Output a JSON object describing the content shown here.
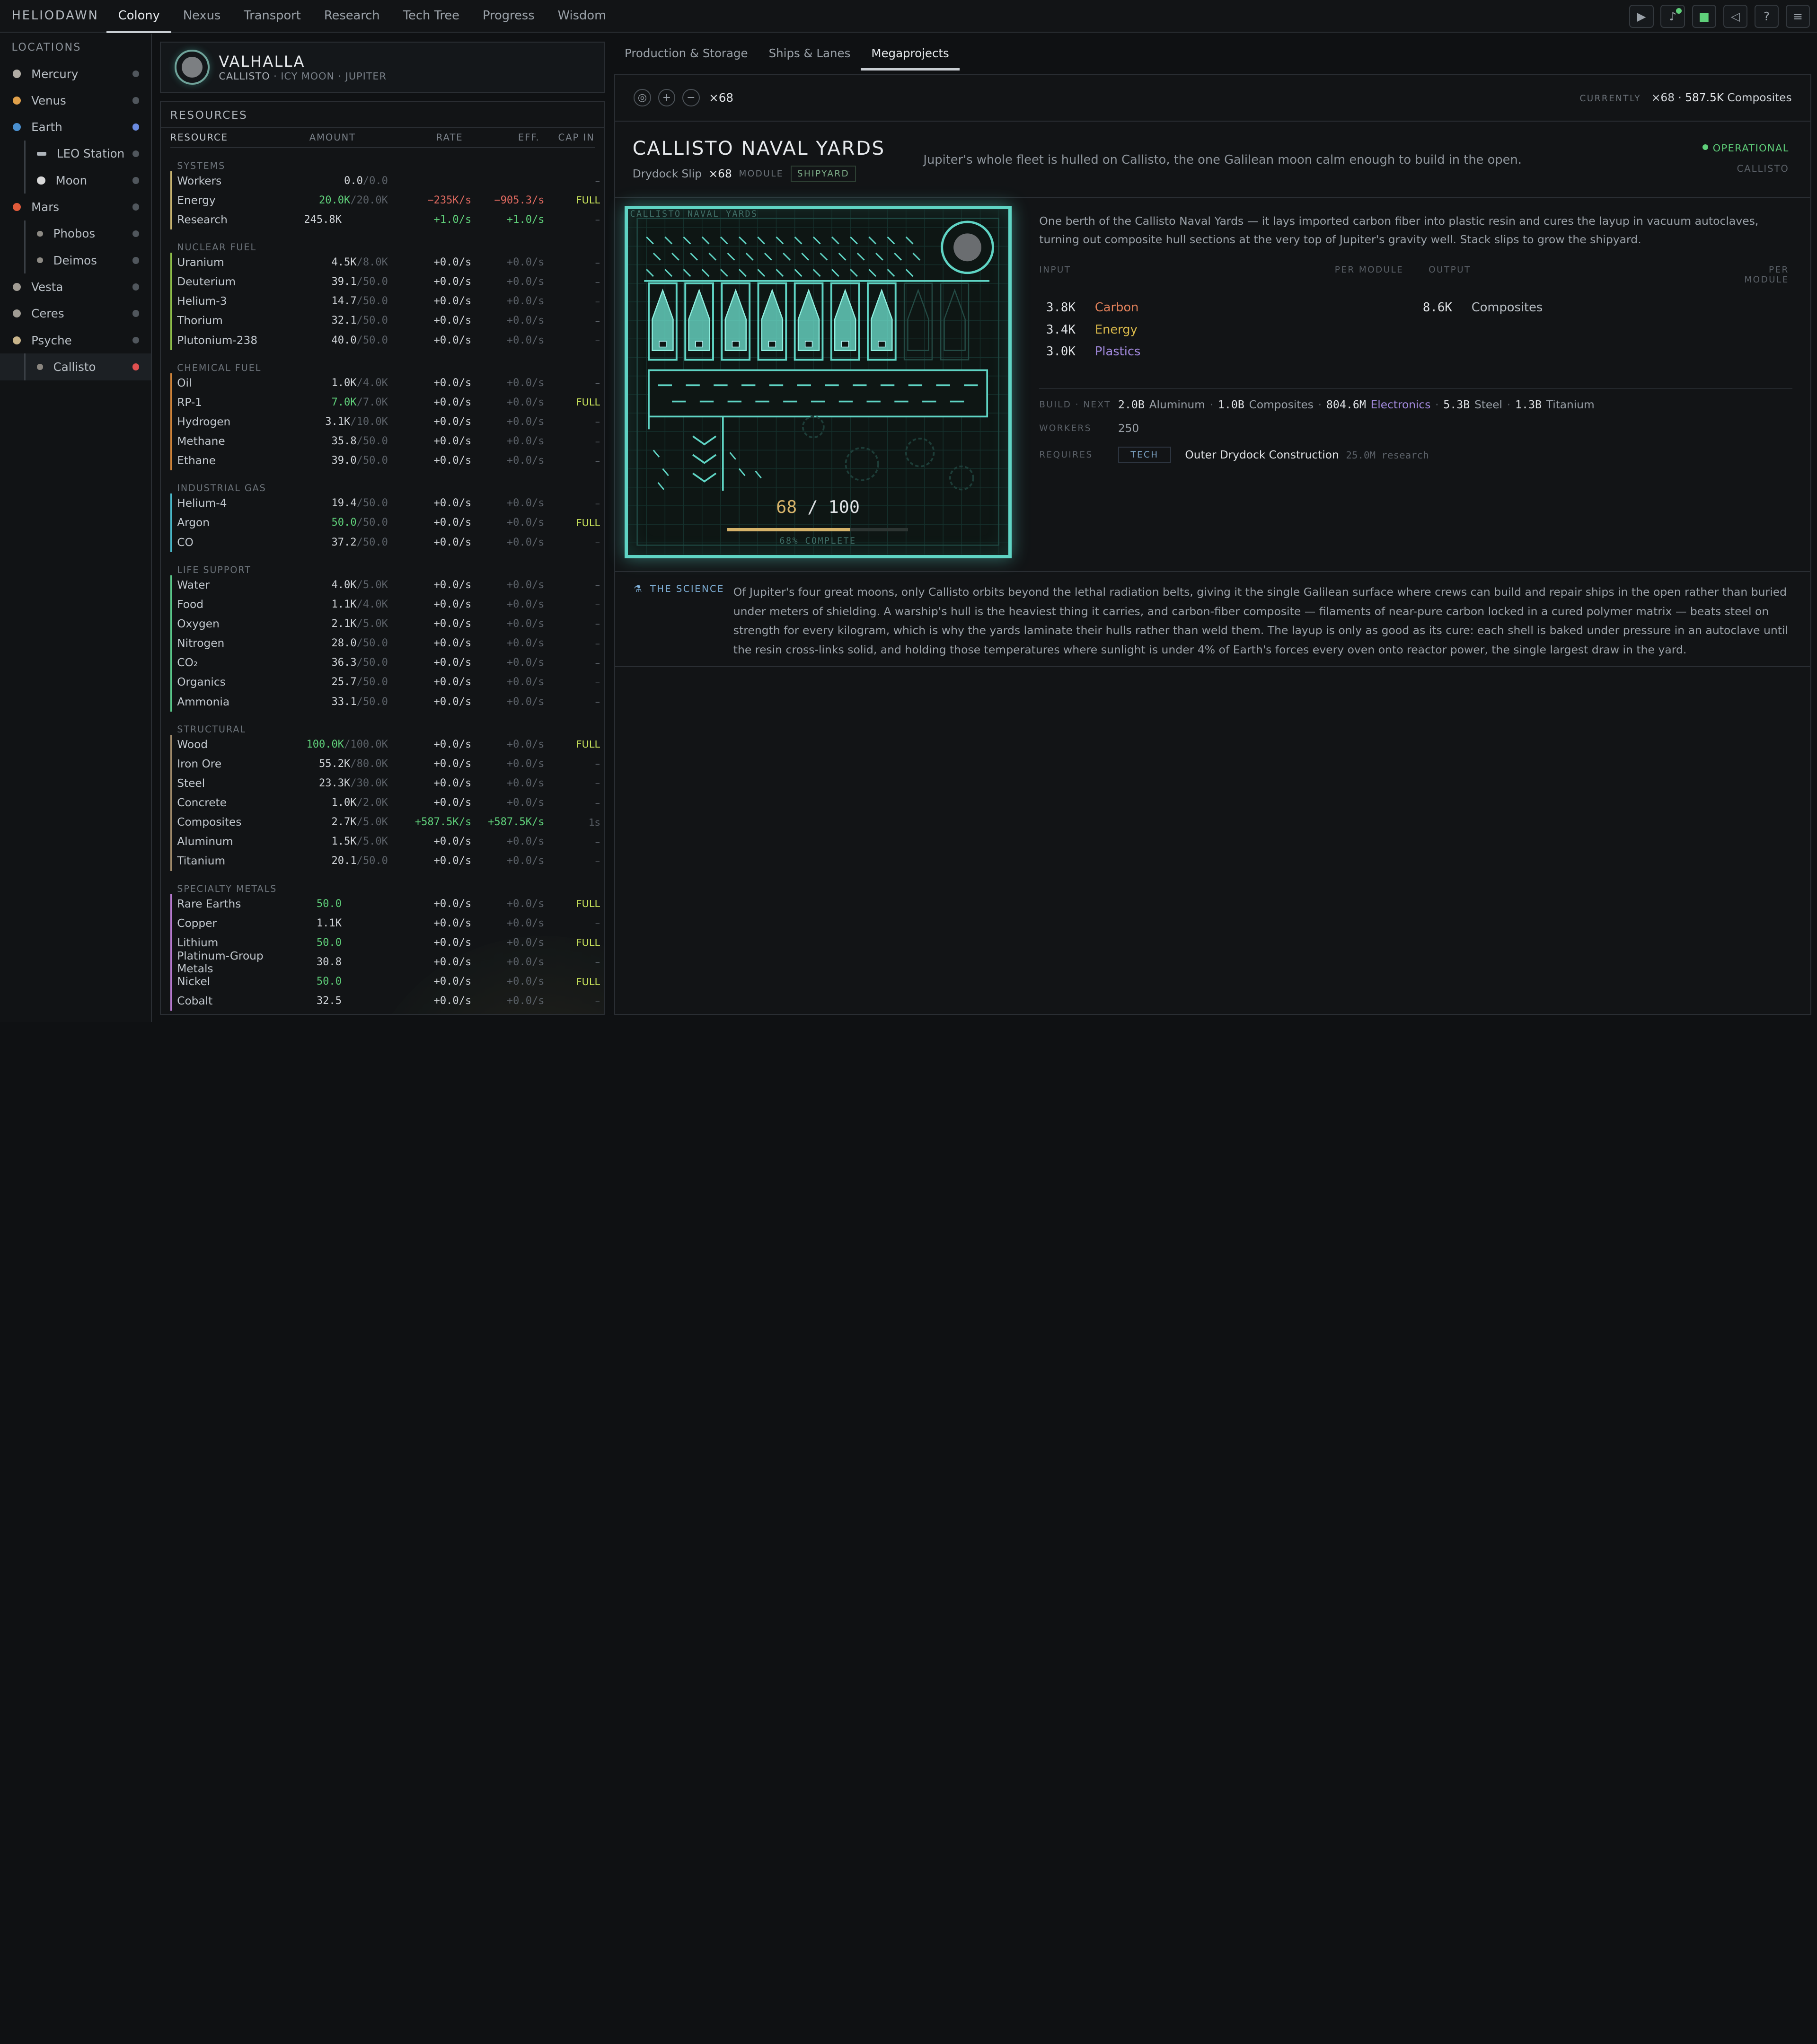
{
  "brand": "HELIODAWN",
  "nav": {
    "tabs": [
      {
        "label": "Colony",
        "active": true
      },
      {
        "label": "Nexus",
        "active": false
      },
      {
        "label": "Transport",
        "active": false
      },
      {
        "label": "Research",
        "active": false
      },
      {
        "label": "Tech Tree",
        "active": false
      },
      {
        "label": "Progress",
        "active": false
      },
      {
        "label": "Wisdom",
        "active": false
      }
    ]
  },
  "topicons": [
    "play-icon",
    "bell-icon",
    "save-icon",
    "mute-icon",
    "help-icon",
    "menu-icon"
  ],
  "sidebar": {
    "title": "LOCATIONS",
    "items": [
      {
        "label": "Mercury",
        "color": "#b0aca4",
        "child": false,
        "status": "#50565c"
      },
      {
        "label": "Venus",
        "color": "#e0a04a",
        "child": false,
        "status": "#50565c"
      },
      {
        "label": "Earth",
        "color": "#4a90d0",
        "child": false,
        "status": "#6b8be0"
      },
      {
        "label": "LEO Station",
        "color": "#aeb4ba",
        "child": true,
        "status": "#50565c"
      },
      {
        "label": "Moon",
        "color": "#d8d8d8",
        "child": true,
        "status": "#50565c"
      },
      {
        "label": "Mars",
        "color": "#e05a3a",
        "child": false,
        "status": "#50565c"
      },
      {
        "label": "Phobos",
        "color": "#8d8a84",
        "child": true,
        "status": "#50565c"
      },
      {
        "label": "Deimos",
        "color": "#8d8a84",
        "child": true,
        "status": "#50565c"
      },
      {
        "label": "Vesta",
        "color": "#a09c94",
        "child": false,
        "status": "#50565c"
      },
      {
        "label": "Ceres",
        "color": "#a09c94",
        "child": false,
        "status": "#50565c"
      },
      {
        "label": "Psyche",
        "color": "#c8b48a",
        "child": false,
        "status": "#50565c"
      },
      {
        "label": "Callisto",
        "color": "#8a8680",
        "child": true,
        "status": "#e05050",
        "selected": true
      }
    ]
  },
  "location": {
    "name": "VALHALLA",
    "body": "CALLISTO",
    "sub": "· ICY MOON · JUPITER"
  },
  "resources": {
    "title": "RESOURCES",
    "headers": [
      "RESOURCE",
      "AMOUNT",
      "RATE",
      "EFF.",
      "CAP IN"
    ],
    "categories": [
      {
        "name": "SYSTEMS",
        "color": "#c8b470",
        "rows": [
          {
            "name": "Workers",
            "amt": "0.0",
            "cap": "/0.0",
            "rate": "",
            "eff": "",
            "capin": "–"
          },
          {
            "name": "Energy",
            "amt": "20.0K",
            "cap": "/20.0K",
            "rate": "−235K/s",
            "eff": "−905.3/s",
            "capin": "FULL",
            "amtc": "pos",
            "ratec": "neg",
            "effc": "neg"
          },
          {
            "name": "Research",
            "amt": "245.8K",
            "cap": "",
            "rate": "+1.0/s",
            "eff": "+1.0/s",
            "capin": "–",
            "ratec": "pos",
            "effc": "pos"
          }
        ]
      },
      {
        "name": "NUCLEAR FUEL",
        "color": "#8fbf4a",
        "rows": [
          {
            "name": "Uranium",
            "amt": "4.5K",
            "cap": "/8.0K",
            "rate": "+0.0/s",
            "eff": "+0.0/s",
            "capin": "–"
          },
          {
            "name": "Deuterium",
            "amt": "39.1",
            "cap": "/50.0",
            "rate": "+0.0/s",
            "eff": "+0.0/s",
            "capin": "–"
          },
          {
            "name": "Helium-3",
            "amt": "14.7",
            "cap": "/50.0",
            "rate": "+0.0/s",
            "eff": "+0.0/s",
            "capin": "–"
          },
          {
            "name": "Thorium",
            "amt": "32.1",
            "cap": "/50.0",
            "rate": "+0.0/s",
            "eff": "+0.0/s",
            "capin": "–"
          },
          {
            "name": "Plutonium-238",
            "amt": "40.0",
            "cap": "/50.0",
            "rate": "+0.0/s",
            "eff": "+0.0/s",
            "capin": "–"
          }
        ]
      },
      {
        "name": "CHEMICAL FUEL",
        "color": "#d0843a",
        "rows": [
          {
            "name": "Oil",
            "amt": "1.0K",
            "cap": "/4.0K",
            "rate": "+0.0/s",
            "eff": "+0.0/s",
            "capin": "–"
          },
          {
            "name": "RP-1",
            "amt": "7.0K",
            "cap": "/7.0K",
            "rate": "+0.0/s",
            "eff": "+0.0/s",
            "capin": "FULL",
            "amtc": "pos"
          },
          {
            "name": "Hydrogen",
            "amt": "3.1K",
            "cap": "/10.0K",
            "rate": "+0.0/s",
            "eff": "+0.0/s",
            "capin": "–"
          },
          {
            "name": "Methane",
            "amt": "35.8",
            "cap": "/50.0",
            "rate": "+0.0/s",
            "eff": "+0.0/s",
            "capin": "–"
          },
          {
            "name": "Ethane",
            "amt": "39.0",
            "cap": "/50.0",
            "rate": "+0.0/s",
            "eff": "+0.0/s",
            "capin": "–"
          }
        ]
      },
      {
        "name": "INDUSTRIAL GAS",
        "color": "#4ab8c8",
        "rows": [
          {
            "name": "Helium-4",
            "amt": "19.4",
            "cap": "/50.0",
            "rate": "+0.0/s",
            "eff": "+0.0/s",
            "capin": "–"
          },
          {
            "name": "Argon",
            "amt": "50.0",
            "cap": "/50.0",
            "rate": "+0.0/s",
            "eff": "+0.0/s",
            "capin": "FULL",
            "amtc": "pos"
          },
          {
            "name": "CO",
            "amt": "37.2",
            "cap": "/50.0",
            "rate": "+0.0/s",
            "eff": "+0.0/s",
            "capin": "–"
          }
        ]
      },
      {
        "name": "LIFE SUPPORT",
        "color": "#5ac88a",
        "rows": [
          {
            "name": "Water",
            "amt": "4.0K",
            "cap": "/5.0K",
            "rate": "+0.0/s",
            "eff": "+0.0/s",
            "capin": "–"
          },
          {
            "name": "Food",
            "amt": "1.1K",
            "cap": "/4.0K",
            "rate": "+0.0/s",
            "eff": "+0.0/s",
            "capin": "–"
          },
          {
            "name": "Oxygen",
            "amt": "2.1K",
            "cap": "/5.0K",
            "rate": "+0.0/s",
            "eff": "+0.0/s",
            "capin": "–"
          },
          {
            "name": "Nitrogen",
            "amt": "28.0",
            "cap": "/50.0",
            "rate": "+0.0/s",
            "eff": "+0.0/s",
            "capin": "–"
          },
          {
            "name": "CO₂",
            "amt": "36.3",
            "cap": "/50.0",
            "rate": "+0.0/s",
            "eff": "+0.0/s",
            "capin": "–"
          },
          {
            "name": "Organics",
            "amt": "25.7",
            "cap": "/50.0",
            "rate": "+0.0/s",
            "eff": "+0.0/s",
            "capin": "–"
          },
          {
            "name": "Ammonia",
            "amt": "33.1",
            "cap": "/50.0",
            "rate": "+0.0/s",
            "eff": "+0.0/s",
            "capin": "–"
          }
        ]
      },
      {
        "name": "STRUCTURAL",
        "color": "#a08a6a",
        "rows": [
          {
            "name": "Wood",
            "amt": "100.0K",
            "cap": "/100.0K",
            "rate": "+0.0/s",
            "eff": "+0.0/s",
            "capin": "FULL",
            "amtc": "pos"
          },
          {
            "name": "Iron Ore",
            "amt": "55.2K",
            "cap": "/80.0K",
            "rate": "+0.0/s",
            "eff": "+0.0/s",
            "capin": "–"
          },
          {
            "name": "Steel",
            "amt": "23.3K",
            "cap": "/30.0K",
            "rate": "+0.0/s",
            "eff": "+0.0/s",
            "capin": "–"
          },
          {
            "name": "Concrete",
            "amt": "1.0K",
            "cap": "/2.0K",
            "rate": "+0.0/s",
            "eff": "+0.0/s",
            "capin": "–"
          },
          {
            "name": "Composites",
            "amt": "2.7K",
            "cap": "/5.0K",
            "rate": "+587.5K/s",
            "eff": "+587.5K/s",
            "capin": "1s",
            "ratec": "pos",
            "effc": "pos"
          },
          {
            "name": "Aluminum",
            "amt": "1.5K",
            "cap": "/5.0K",
            "rate": "+0.0/s",
            "eff": "+0.0/s",
            "capin": "–"
          },
          {
            "name": "Titanium",
            "amt": "20.1",
            "cap": "/50.0",
            "rate": "+0.0/s",
            "eff": "+0.0/s",
            "capin": "–"
          }
        ]
      },
      {
        "name": "SPECIALTY METALS",
        "color": "#b87ad0",
        "rows": [
          {
            "name": "Rare Earths",
            "amt": "50.0",
            "cap": "",
            "rate": "+0.0/s",
            "eff": "+0.0/s",
            "capin": "FULL",
            "amtc": "pos"
          },
          {
            "name": "Copper",
            "amt": "1.1K",
            "cap": "",
            "rate": "+0.0/s",
            "eff": "+0.0/s",
            "capin": "–"
          },
          {
            "name": "Lithium",
            "amt": "50.0",
            "cap": "",
            "rate": "+0.0/s",
            "eff": "+0.0/s",
            "capin": "FULL",
            "amtc": "pos"
          },
          {
            "name": "Platinum-Group Metals",
            "amt": "30.8",
            "cap": "",
            "rate": "+0.0/s",
            "eff": "+0.0/s",
            "capin": "–"
          },
          {
            "name": "Nickel",
            "amt": "50.0",
            "cap": "",
            "rate": "+0.0/s",
            "eff": "+0.0/s",
            "capin": "FULL",
            "amtc": "pos"
          },
          {
            "name": "Cobalt",
            "amt": "32.5",
            "cap": "",
            "rate": "+0.0/s",
            "eff": "+0.0/s",
            "capin": "–"
          }
        ]
      }
    ]
  },
  "rtabs": [
    {
      "label": "Production & Storage",
      "active": false
    },
    {
      "label": "Ships & Lanes",
      "active": false
    },
    {
      "label": "Megaprojects",
      "active": true
    }
  ],
  "toolbar": {
    "multiplier": "×68",
    "currently_label": "CURRENTLY",
    "currently_mult": "×68",
    "currently_sep": " · ",
    "currently_value": "587.5K",
    "currently_unit": "Composites"
  },
  "project": {
    "title": "CALLISTO NAVAL YARDS",
    "module_name": "Drydock Slip",
    "module_mult": "×68",
    "module_label": "MODULE",
    "tag": "SHIPYARD",
    "tagline": "Jupiter's whole fleet is hulled on Callisto, the one Galilean moon calm enough to build in the open.",
    "status": "OPERATIONAL",
    "location": "CALLISTO",
    "illus_label": "CALLISTO NAVAL YARDS",
    "progress_current": "68",
    "progress_sep": " / ",
    "progress_total": "100",
    "progress_fraction": 0.68,
    "progress_text": "68% COMPLETE",
    "description": "One berth of the Callisto Naval Yards — it lays imported carbon fiber into plastic resin and cures the layup in vacuum autoclaves, turning out composite hull sections at the very top of Jupiter's gravity well. Stack slips to grow the shipyard.",
    "input_label": "INPUT",
    "per_module": "PER MODULE",
    "output_label": "OUTPUT",
    "inputs": [
      {
        "qty": "3.8K",
        "name": "Carbon",
        "color": "#e0805a"
      },
      {
        "qty": "3.4K",
        "name": "Energy",
        "color": "#d8b84a"
      },
      {
        "qty": "3.0K",
        "name": "Plastics",
        "color": "#a48be0"
      }
    ],
    "outputs": [
      {
        "qty": "8.6K",
        "name": "Composites",
        "color": "#b8bec4"
      }
    ],
    "build_label": "BUILD · NEXT",
    "build": [
      {
        "qty": "2.0B",
        "name": "Aluminum",
        "color": "#9aa1a8"
      },
      {
        "qty": "1.0B",
        "name": "Composites",
        "color": "#9aa1a8"
      },
      {
        "qty": "804.6M",
        "name": "Electronics",
        "color": "#a48be0"
      },
      {
        "qty": "5.3B",
        "name": "Steel",
        "color": "#9aa1a8"
      },
      {
        "qty": "1.3B",
        "name": "Titanium",
        "color": "#9aa1a8"
      }
    ],
    "build_sep": "·",
    "workers_label": "WORKERS",
    "workers": "250",
    "requires_label": "REQUIRES",
    "requires_tag": "TECH",
    "requires_name": "Outer Drydock Construction",
    "requires_cost": "25.0M research"
  },
  "science": {
    "label": "THE SCIENCE",
    "text": "Of Jupiter's four great moons, only Callisto orbits beyond the lethal radiation belts, giving it the single Galilean surface where crews can build and repair ships in the open rather than buried under meters of shielding. A warship's hull is the heaviest thing it carries, and carbon-fiber composite — filaments of near-pure carbon locked in a cured polymer matrix — beats steel on strength for every kilogram, which is why the yards laminate their hulls rather than weld them. The layup is only as good as its cure: each shell is baked under pressure in an autoclave until the resin cross-links solid, and holding those temperatures where sunlight is under 4% of Earth's forces every oven onto reactor power, the single largest draw in the yard."
  },
  "colors": {
    "accent": "#58d8c8",
    "gold": "#d6b36a",
    "green": "#5fd07a",
    "red": "#e06a60"
  },
  "ships": {
    "built": 7,
    "total": 9
  }
}
